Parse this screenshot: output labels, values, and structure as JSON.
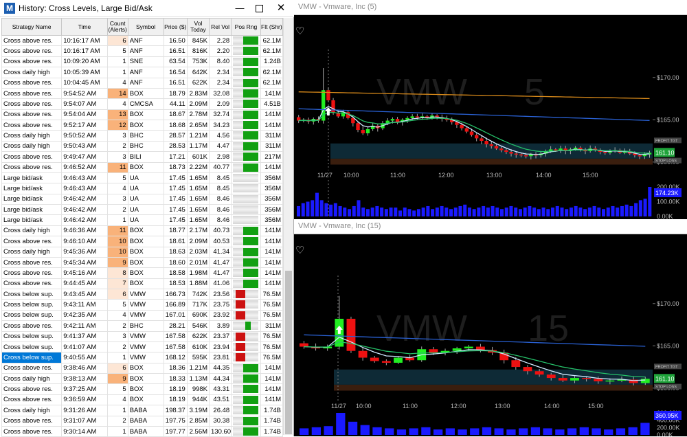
{
  "window": {
    "app_icon": "M",
    "title": "History:  Cross Levels, Large Bid/Ask",
    "min": "—",
    "close": "✕"
  },
  "columns": {
    "strategy": "Strategy Name",
    "time": "Time",
    "count": "Count (Alerts)",
    "symbol": "Symbol",
    "price": "Price ($)",
    "vol": "Vol Today",
    "rel": "Rel Vol",
    "pos": "Pos Rng",
    "flt": "Flt (Shr)"
  },
  "colors": {
    "count_high": "#f9b27a",
    "count_low": "#fde6d5",
    "pos_green": "#12a012",
    "pos_red": "#cc1111",
    "selection": "#0078d7",
    "chart_up": "#22ee22",
    "chart_down": "#ee1111",
    "volume": "#1a1aff"
  },
  "rows": [
    {
      "strategy": "Cross above res.",
      "time": "10:16:17 AM",
      "count": "6",
      "symbol": "ANF",
      "price": "16.50",
      "vol": "845K",
      "rel": "2.28",
      "pos": "green",
      "flt": "62.1M"
    },
    {
      "strategy": "Cross above res.",
      "time": "10:16:17 AM",
      "count": "5",
      "symbol": "ANF",
      "price": "16.51",
      "vol": "816K",
      "rel": "2.20",
      "pos": "green",
      "flt": "62.1M"
    },
    {
      "strategy": "Cross above res.",
      "time": "10:09:20 AM",
      "count": "1",
      "symbol": "SNE",
      "price": "63.54",
      "vol": "753K",
      "rel": "8.40",
      "pos": "green",
      "flt": "1.24B"
    },
    {
      "strategy": "Cross daily high",
      "time": "10:05:39 AM",
      "count": "1",
      "symbol": "ANF",
      "price": "16.54",
      "vol": "642K",
      "rel": "2.34",
      "pos": "green",
      "flt": "62.1M"
    },
    {
      "strategy": "Cross above res.",
      "time": "10:04:45 AM",
      "count": "4",
      "symbol": "ANF",
      "price": "16.51",
      "vol": "622K",
      "rel": "2.34",
      "pos": "green",
      "flt": "62.1M"
    },
    {
      "strategy": "Cross above res.",
      "time": "9:54:52 AM",
      "count": "14",
      "symbol": "BOX",
      "price": "18.79",
      "vol": "2.83M",
      "rel": "32.08",
      "pos": "green",
      "flt": "141M"
    },
    {
      "strategy": "Cross above res.",
      "time": "9:54:07 AM",
      "count": "4",
      "symbol": "CMCSA",
      "price": "44.11",
      "vol": "2.09M",
      "rel": "2.09",
      "pos": "green",
      "flt": "4.51B"
    },
    {
      "strategy": "Cross above res.",
      "time": "9:54:04 AM",
      "count": "13",
      "symbol": "BOX",
      "price": "18.67",
      "vol": "2.78M",
      "rel": "32.74",
      "pos": "green",
      "flt": "141M"
    },
    {
      "strategy": "Cross above res.",
      "time": "9:52:17 AM",
      "count": "12",
      "symbol": "BOX",
      "price": "18.68",
      "vol": "2.65M",
      "rel": "34.23",
      "pos": "green",
      "flt": "141M"
    },
    {
      "strategy": "Cross daily high",
      "time": "9:50:52 AM",
      "count": "3",
      "symbol": "BHC",
      "price": "28.57",
      "vol": "1.21M",
      "rel": "4.56",
      "pos": "green",
      "flt": "311M"
    },
    {
      "strategy": "Cross daily high",
      "time": "9:50:43 AM",
      "count": "2",
      "symbol": "BHC",
      "price": "28.53",
      "vol": "1.17M",
      "rel": "4.47",
      "pos": "green",
      "flt": "311M"
    },
    {
      "strategy": "Cross above res.",
      "time": "9:49:47 AM",
      "count": "3",
      "symbol": "BILI",
      "price": "17.21",
      "vol": "601K",
      "rel": "2.98",
      "pos": "green",
      "flt": "217M"
    },
    {
      "strategy": "Cross above res.",
      "time": "9:46:52 AM",
      "count": "11",
      "symbol": "BOX",
      "price": "18.73",
      "vol": "2.22M",
      "rel": "40.77",
      "pos": "green",
      "flt": "141M"
    },
    {
      "strategy": "Large bid/ask",
      "time": "9:46:43 AM",
      "count": "5",
      "symbol": "UA",
      "price": "17.45",
      "vol": "1.65M",
      "rel": "8.45",
      "pos": "none",
      "flt": "356M"
    },
    {
      "strategy": "Large bid/ask",
      "time": "9:46:43 AM",
      "count": "4",
      "symbol": "UA",
      "price": "17.45",
      "vol": "1.65M",
      "rel": "8.45",
      "pos": "none",
      "flt": "356M"
    },
    {
      "strategy": "Large bid/ask",
      "time": "9:46:42 AM",
      "count": "3",
      "symbol": "UA",
      "price": "17.45",
      "vol": "1.65M",
      "rel": "8.46",
      "pos": "none",
      "flt": "356M"
    },
    {
      "strategy": "Large bid/ask",
      "time": "9:46:42 AM",
      "count": "2",
      "symbol": "UA",
      "price": "17.45",
      "vol": "1.65M",
      "rel": "8.46",
      "pos": "none",
      "flt": "356M"
    },
    {
      "strategy": "Large bid/ask",
      "time": "9:46:42 AM",
      "count": "1",
      "symbol": "UA",
      "price": "17.45",
      "vol": "1.65M",
      "rel": "8.46",
      "pos": "none",
      "flt": "356M"
    },
    {
      "strategy": "Cross daily high",
      "time": "9:46:36 AM",
      "count": "11",
      "symbol": "BOX",
      "price": "18.77",
      "vol": "2.17M",
      "rel": "40.73",
      "pos": "green",
      "flt": "141M"
    },
    {
      "strategy": "Cross above res.",
      "time": "9:46:10 AM",
      "count": "10",
      "symbol": "BOX",
      "price": "18.61",
      "vol": "2.09M",
      "rel": "40.53",
      "pos": "green",
      "flt": "141M"
    },
    {
      "strategy": "Cross daily high",
      "time": "9:45:36 AM",
      "count": "10",
      "symbol": "BOX",
      "price": "18.63",
      "vol": "2.03M",
      "rel": "41.34",
      "pos": "green",
      "flt": "141M"
    },
    {
      "strategy": "Cross above res.",
      "time": "9:45:34 AM",
      "count": "9",
      "symbol": "BOX",
      "price": "18.60",
      "vol": "2.01M",
      "rel": "41.47",
      "pos": "green",
      "flt": "141M"
    },
    {
      "strategy": "Cross above res.",
      "time": "9:45:16 AM",
      "count": "8",
      "symbol": "BOX",
      "price": "18.58",
      "vol": "1.98M",
      "rel": "41.47",
      "pos": "green",
      "flt": "141M"
    },
    {
      "strategy": "Cross above res.",
      "time": "9:44:45 AM",
      "count": "7",
      "symbol": "BOX",
      "price": "18.53",
      "vol": "1.88M",
      "rel": "41.06",
      "pos": "green",
      "flt": "141M"
    },
    {
      "strategy": "Cross below sup.",
      "time": "9:43:45 AM",
      "count": "6",
      "symbol": "VMW",
      "price": "166.73",
      "vol": "742K",
      "rel": "23.56",
      "pos": "red",
      "flt": "76.5M"
    },
    {
      "strategy": "Cross below sup.",
      "time": "9:43:11 AM",
      "count": "5",
      "symbol": "VMW",
      "price": "166.89",
      "vol": "717K",
      "rel": "23.75",
      "pos": "red",
      "flt": "76.5M"
    },
    {
      "strategy": "Cross below sup.",
      "time": "9:42:35 AM",
      "count": "4",
      "symbol": "VMW",
      "price": "167.01",
      "vol": "690K",
      "rel": "23.92",
      "pos": "red",
      "flt": "76.5M"
    },
    {
      "strategy": "Cross above res.",
      "time": "9:42:11 AM",
      "count": "2",
      "symbol": "BHC",
      "price": "28.21",
      "vol": "546K",
      "rel": "3.89",
      "pos": "green-mid",
      "flt": "311M"
    },
    {
      "strategy": "Cross below sup.",
      "time": "9:41:37 AM",
      "count": "3",
      "symbol": "VMW",
      "price": "167.58",
      "vol": "622K",
      "rel": "23.37",
      "pos": "red",
      "flt": "76.5M"
    },
    {
      "strategy": "Cross below sup.",
      "time": "9:41:07 AM",
      "count": "2",
      "symbol": "VMW",
      "price": "167.58",
      "vol": "610K",
      "rel": "23.94",
      "pos": "red",
      "flt": "76.5M"
    },
    {
      "strategy": "Cross below sup.",
      "time": "9:40:55 AM",
      "count": "1",
      "symbol": "VMW",
      "price": "168.12",
      "vol": "595K",
      "rel": "23.81",
      "pos": "red",
      "flt": "76.5M",
      "selected": true
    },
    {
      "strategy": "Cross above res.",
      "time": "9:38:46 AM",
      "count": "6",
      "symbol": "BOX",
      "price": "18.36",
      "vol": "1.21M",
      "rel": "44.35",
      "pos": "green",
      "flt": "141M"
    },
    {
      "strategy": "Cross daily high",
      "time": "9:38:13 AM",
      "count": "9",
      "symbol": "BOX",
      "price": "18.33",
      "vol": "1.13M",
      "rel": "44.34",
      "pos": "green",
      "flt": "141M"
    },
    {
      "strategy": "Cross above res.",
      "time": "9:37:25 AM",
      "count": "5",
      "symbol": "BOX",
      "price": "18.19",
      "vol": "998K",
      "rel": "43.31",
      "pos": "green",
      "flt": "141M"
    },
    {
      "strategy": "Cross above res.",
      "time": "9:36:59 AM",
      "count": "4",
      "symbol": "BOX",
      "price": "18.19",
      "vol": "944K",
      "rel": "43.51",
      "pos": "green",
      "flt": "141M"
    },
    {
      "strategy": "Cross daily high",
      "time": "9:31:26 AM",
      "count": "1",
      "symbol": "BABA",
      "price": "198.37",
      "vol": "3.19M",
      "rel": "26.48",
      "pos": "green",
      "flt": "1.74B"
    },
    {
      "strategy": "Cross above res.",
      "time": "9:31:07 AM",
      "count": "2",
      "symbol": "BABA",
      "price": "197.75",
      "vol": "2.85M",
      "rel": "30.38",
      "pos": "green",
      "flt": "1.74B"
    },
    {
      "strategy": "Cross above res.",
      "time": "9:30:14 AM",
      "count": "1",
      "symbol": "BABA",
      "price": "197.77",
      "vol": "2.56M",
      "rel": "130.60",
      "pos": "green",
      "flt": "1.74B"
    }
  ],
  "charts": [
    {
      "title": "VMW - Vmware, Inc (5)",
      "watermark_symbol": "VMW",
      "watermark_period": "5",
      "price_labels": [
        "$170.00",
        "$165.00",
        "$160.00"
      ],
      "tags": [
        "PROFIT TGT",
        "STOP LOSS"
      ],
      "last_price": "161.10",
      "time_labels": [
        "11/27",
        "10:00",
        "11:00",
        "12:00",
        "13:00",
        "14:00",
        "15:00"
      ],
      "volume_labels": [
        "200.00K",
        "100.00K",
        "0.00K"
      ],
      "last_volume": "174.23K",
      "price_min": 159.5,
      "price_max": 172.5,
      "volumes": [
        0.35,
        0.45,
        0.5,
        0.55,
        0.8,
        0.55,
        0.45,
        0.4,
        0.45,
        0.35,
        0.3,
        0.25,
        0.35,
        0.55,
        0.3,
        0.25,
        0.3,
        0.35,
        0.3,
        0.25,
        0.3,
        0.3,
        0.2,
        0.3,
        0.25,
        0.2,
        0.25,
        0.3,
        0.35,
        0.25,
        0.3,
        0.35,
        0.3,
        0.25,
        0.3,
        0.35,
        0.4,
        0.3,
        0.25,
        0.3,
        0.35,
        0.3,
        0.35,
        0.3,
        0.25,
        0.3,
        0.35,
        0.3,
        0.25,
        0.3,
        0.35,
        0.3,
        0.25,
        0.3,
        0.25,
        0.3,
        0.35,
        0.3,
        0.25,
        0.3,
        0.35,
        0.3,
        0.25,
        0.3,
        0.35,
        0.3,
        0.25,
        0.3,
        0.35,
        0.3,
        0.35,
        0.4,
        0.35,
        0.45,
        0.55,
        0.6,
        1.0
      ]
    },
    {
      "title": "VMW - Vmware, Inc (15)",
      "watermark_symbol": "VMW",
      "watermark_period": "15",
      "price_labels": [
        "$170.00",
        "$165.00",
        "$160.00"
      ],
      "tags": [
        "PROFIT TGT",
        "STOP LOSS"
      ],
      "last_price": "161.10",
      "time_labels": [
        "11/27",
        "10:00",
        "11:00",
        "12:00",
        "13:00",
        "14:00",
        "15:00"
      ],
      "volume_labels": [
        "600.00K",
        "400.00K",
        "200.00K",
        "0.00K"
      ],
      "last_volume": "360.95K",
      "price_min": 159.5,
      "price_max": 172.5,
      "volumes": [
        0.3,
        0.35,
        0.4,
        1.0,
        0.6,
        0.45,
        0.35,
        0.3,
        0.25,
        0.3,
        0.35,
        0.25,
        0.3,
        0.25,
        0.3,
        0.35,
        0.3,
        0.25,
        0.3,
        0.35,
        0.3,
        0.25,
        0.3,
        0.35,
        0.3,
        0.25,
        0.3,
        0.35,
        0.55
      ]
    }
  ]
}
